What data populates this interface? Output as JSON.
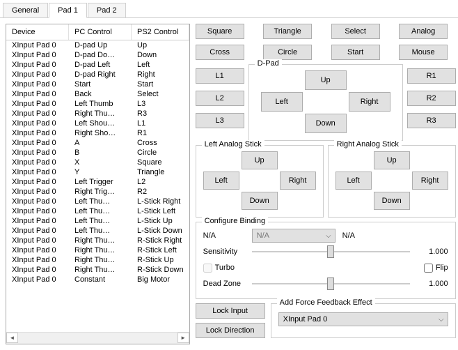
{
  "tabs": [
    {
      "label": "General"
    },
    {
      "label": "Pad 1"
    },
    {
      "label": "Pad 2"
    }
  ],
  "active_tab": 1,
  "table": {
    "headers": {
      "device": "Device",
      "pc": "PC Control",
      "ps2": "PS2 Control"
    },
    "rows": [
      {
        "device": "XInput Pad 0",
        "pc": "D-pad Up",
        "ps2": "Up"
      },
      {
        "device": "XInput Pad 0",
        "pc": "D-pad Do…",
        "ps2": "Down"
      },
      {
        "device": "XInput Pad 0",
        "pc": "D-pad Left",
        "ps2": "Left"
      },
      {
        "device": "XInput Pad 0",
        "pc": "D-pad Right",
        "ps2": "Right"
      },
      {
        "device": "XInput Pad 0",
        "pc": "Start",
        "ps2": "Start"
      },
      {
        "device": "XInput Pad 0",
        "pc": "Back",
        "ps2": "Select"
      },
      {
        "device": "XInput Pad 0",
        "pc": "Left Thumb",
        "ps2": "L3"
      },
      {
        "device": "XInput Pad 0",
        "pc": "Right Thu…",
        "ps2": "R3"
      },
      {
        "device": "XInput Pad 0",
        "pc": "Left Shou…",
        "ps2": "L1"
      },
      {
        "device": "XInput Pad 0",
        "pc": "Right Sho…",
        "ps2": "R1"
      },
      {
        "device": "XInput Pad 0",
        "pc": "A",
        "ps2": "Cross"
      },
      {
        "device": "XInput Pad 0",
        "pc": "B",
        "ps2": "Circle"
      },
      {
        "device": "XInput Pad 0",
        "pc": "X",
        "ps2": "Square"
      },
      {
        "device": "XInput Pad 0",
        "pc": "Y",
        "ps2": "Triangle"
      },
      {
        "device": "XInput Pad 0",
        "pc": "Left Trigger",
        "ps2": "L2"
      },
      {
        "device": "XInput Pad 0",
        "pc": "Right Trig…",
        "ps2": "R2"
      },
      {
        "device": "XInput Pad 0",
        "pc": "Left Thu…",
        "ps2": "L-Stick Right"
      },
      {
        "device": "XInput Pad 0",
        "pc": "Left Thu…",
        "ps2": "L-Stick Left"
      },
      {
        "device": "XInput Pad 0",
        "pc": "Left Thu…",
        "ps2": "L-Stick Up"
      },
      {
        "device": "XInput Pad 0",
        "pc": "Left Thu…",
        "ps2": "L-Stick Down"
      },
      {
        "device": "XInput Pad 0",
        "pc": "Right Thu…",
        "ps2": "R-Stick Right"
      },
      {
        "device": "XInput Pad 0",
        "pc": "Right Thu…",
        "ps2": "R-Stick Left"
      },
      {
        "device": "XInput Pad 0",
        "pc": "Right Thu…",
        "ps2": "R-Stick Up"
      },
      {
        "device": "XInput Pad 0",
        "pc": "Right Thu…",
        "ps2": "R-Stick Down"
      },
      {
        "device": "XInput Pad 0",
        "pc": "Constant",
        "ps2": "Big Motor"
      }
    ]
  },
  "buttons": {
    "square": "Square",
    "triangle": "Triangle",
    "select": "Select",
    "analog": "Analog",
    "cross": "Cross",
    "circle": "Circle",
    "start": "Start",
    "mouse": "Mouse",
    "l1": "L1",
    "l2": "L2",
    "l3": "L3",
    "r1": "R1",
    "r2": "R2",
    "r3": "R3"
  },
  "dpad": {
    "legend": "D-Pad",
    "up": "Up",
    "down": "Down",
    "left": "Left",
    "right": "Right"
  },
  "lstick": {
    "legend": "Left Analog Stick",
    "up": "Up",
    "down": "Down",
    "left": "Left",
    "right": "Right"
  },
  "rstick": {
    "legend": "Right Analog Stick",
    "up": "Up",
    "down": "Down",
    "left": "Left",
    "right": "Right"
  },
  "config": {
    "legend": "Configure Binding",
    "na": "N/A",
    "combo": "N/A",
    "na2": "N/A",
    "sensitivity_label": "Sensitivity",
    "sensitivity_value": "1.000",
    "turbo_label": "Turbo",
    "flip_label": "Flip",
    "deadzone_label": "Dead Zone",
    "deadzone_value": "1.000"
  },
  "lock": {
    "input": "Lock Input",
    "direction": "Lock Direction"
  },
  "ff": {
    "legend": "Add Force Feedback Effect",
    "device": "XInput Pad 0"
  }
}
